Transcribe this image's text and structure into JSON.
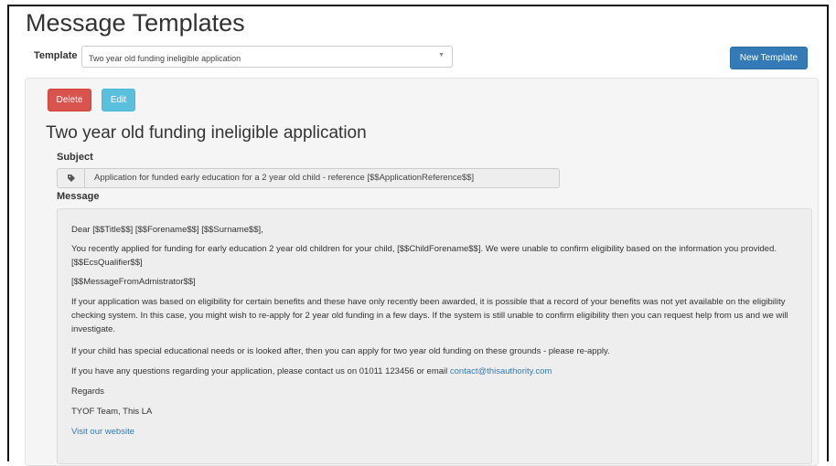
{
  "page": {
    "title": "Message Templates"
  },
  "template_select": {
    "label": "Template",
    "value": "Two year old funding ineligible application",
    "caret": "▼"
  },
  "buttons": {
    "new_template": "New Template",
    "delete": "Delete",
    "edit": "Edit"
  },
  "template": {
    "heading": "Two year old funding ineligible application",
    "subject_label": "Subject",
    "subject": "Application for funded early education for a 2 year old child - reference [$$ApplicationReference$$]",
    "message_label": "Message",
    "message": {
      "greeting": "Dear [$$Title$$] [$$Forename$$] [$$Surname$$],",
      "p1": "You recently applied for funding for early education 2 year old children for your child, [$$ChildForename$$]. We were unable to confirm eligibility based on the information you provided. [$$EcsQualifier$$]",
      "p2": "[$$MessageFromAdmistrator$$]",
      "p3": "If your application was based on eligibility for certain benefits and these have only recently been awarded, it is possible that a record of your benefits was not yet available on the eligibility checking system. In this case, you might wish to re-apply for 2 year old funding in a few days. If the system is still unable to confirm eligibility then you can request help from us and we will investigate.",
      "p4": "If your child has special educational needs or is looked after, then you can apply for two year old funding on these grounds - please re-apply.",
      "p5_text": "If you have any questions regarding your application, please contact us on 01011 123456 or email ",
      "p5_email": "contact@thisauthority.com",
      "regards": "Regards",
      "signoff": "TYOF Team, This LA",
      "website_link": "Visit our website"
    }
  },
  "colors": {
    "primary": "#337ab7",
    "danger": "#d9534f",
    "info": "#5bc0de"
  },
  "icons": {
    "subject_addon": "tag-icon"
  }
}
